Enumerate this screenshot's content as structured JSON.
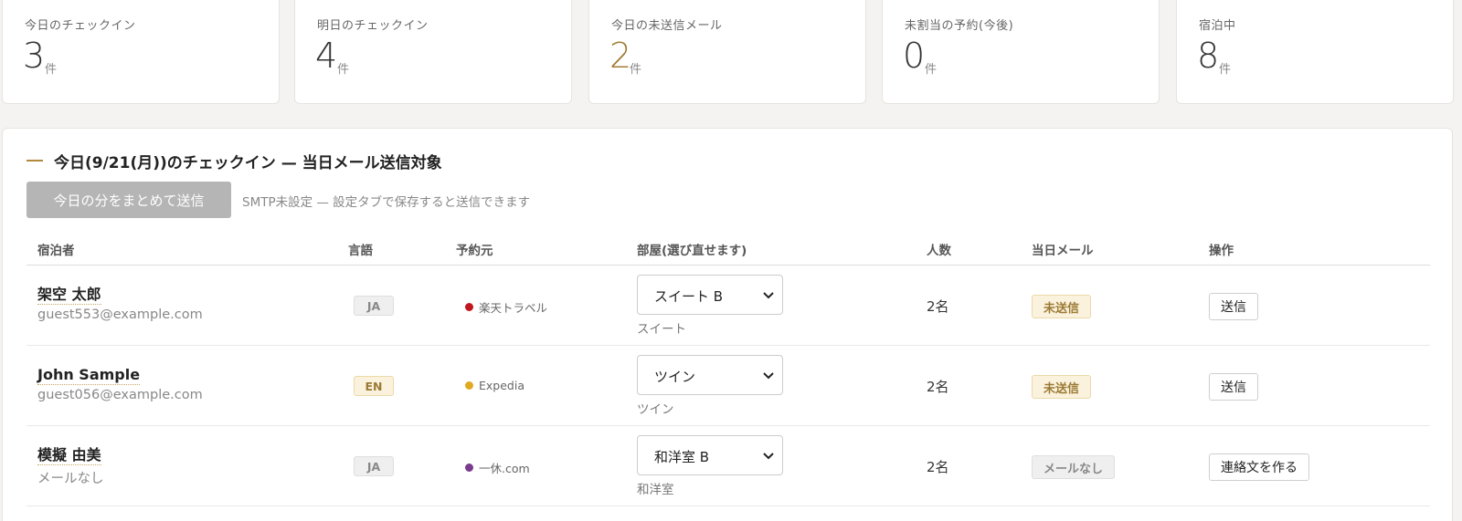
{
  "stats": [
    {
      "label": "今日のチェックイン",
      "value": "3",
      "unit": "件"
    },
    {
      "label": "明日のチェックイン",
      "value": "4",
      "unit": "件"
    },
    {
      "label": "今日の未送信メール",
      "value": "2",
      "unit": "件"
    },
    {
      "label": "未割当の予約(今後)",
      "value": "0",
      "unit": "件"
    },
    {
      "label": "宿泊中",
      "value": "8",
      "unit": "件"
    }
  ],
  "section": {
    "title": "今日(9/21(月))のチェックイン — 当日メール送信対象",
    "bulk_send_label": "今日の分をまとめて送信",
    "smtp_note": "SMTP未設定 — 設定タブで保存すると送信できます"
  },
  "table": {
    "headers": {
      "guest": "宿泊者",
      "language": "言語",
      "source": "予約元",
      "room": "部屋(選び直せます)",
      "people": "人数",
      "mail": "当日メール",
      "action": "操作"
    },
    "rows": [
      {
        "name": "架空 太郎",
        "email": "guest553@example.com",
        "lang": "JA",
        "source": "楽天トラベル",
        "source_color": "#c0161d",
        "room": "スイート B",
        "room_type": "スイート",
        "people": "2名",
        "mail_status": "未送信",
        "action": "送信"
      },
      {
        "name": "John Sample",
        "email": "guest056@example.com",
        "lang": "EN",
        "source": "Expedia",
        "source_color": "#e0a920",
        "room": "ツイン",
        "room_type": "ツイン",
        "people": "2名",
        "mail_status": "未送信",
        "action": "送信"
      },
      {
        "name": "模擬 由美",
        "email": "メールなし",
        "lang": "JA",
        "source": "一休.com",
        "source_color": "#7a3b8f",
        "room": "和洋室 B",
        "room_type": "和洋室",
        "people": "2名",
        "mail_status": "メールなし",
        "action": "連絡文を作る"
      }
    ]
  }
}
